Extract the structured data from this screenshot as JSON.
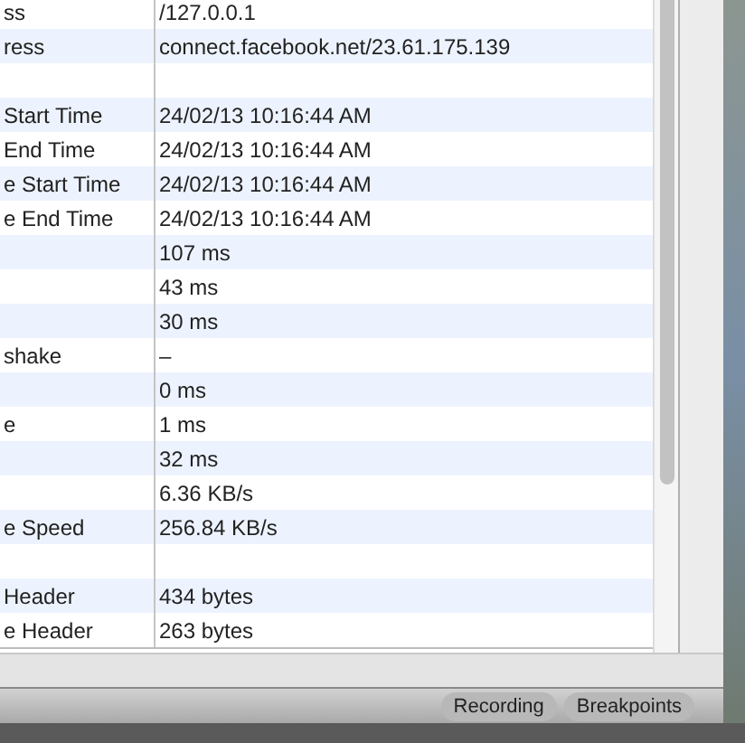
{
  "table": {
    "rows": [
      {
        "label": "ss",
        "value": "/127.0.0.1"
      },
      {
        "label": "ress",
        "value": "connect.facebook.net/23.61.175.139"
      },
      {
        "label": "",
        "value": ""
      },
      {
        "label": "Start Time",
        "value": "24/02/13 10:16:44 AM"
      },
      {
        "label": "End Time",
        "value": "24/02/13 10:16:44 AM"
      },
      {
        "label": "e Start Time",
        "value": "24/02/13 10:16:44 AM"
      },
      {
        "label": "e End Time",
        "value": "24/02/13 10:16:44 AM"
      },
      {
        "label": "",
        "value": "107 ms"
      },
      {
        "label": "",
        "value": "43 ms"
      },
      {
        "label": "",
        "value": "30 ms"
      },
      {
        "label": "shake",
        "value": "–"
      },
      {
        "label": "",
        "value": "0 ms"
      },
      {
        "label": "e",
        "value": "1 ms"
      },
      {
        "label": "",
        "value": "32 ms"
      },
      {
        "label": "",
        "value": "6.36 KB/s"
      },
      {
        "label": "e Speed",
        "value": "256.84 KB/s"
      },
      {
        "label": "",
        "value": ""
      },
      {
        "label": "Header",
        "value": "434 bytes"
      },
      {
        "label": "e Header",
        "value": "263 bytes"
      }
    ]
  },
  "status_bar": {
    "buttons": [
      {
        "label": "Recording"
      },
      {
        "label": "Breakpoints"
      }
    ]
  }
}
